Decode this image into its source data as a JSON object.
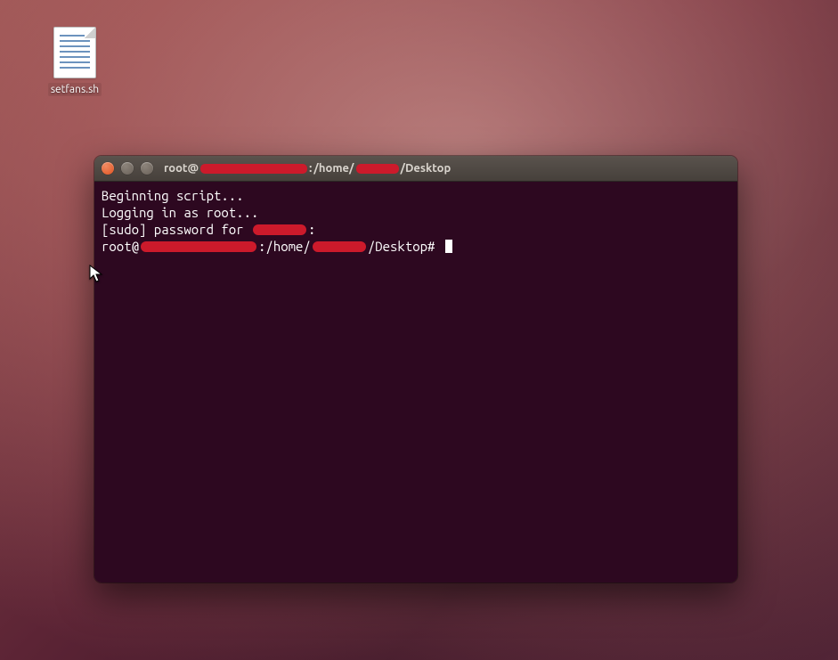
{
  "desktop_icon": {
    "label": "setfans.sh"
  },
  "window": {
    "title_prefix": "root@",
    "title_mid1": ":",
    "title_path1": "/home/",
    "title_path2": "/Desktop"
  },
  "terminal": {
    "line1": "Beginning script...",
    "line2": "Logging in as root...",
    "line3_pre": "[sudo] password for ",
    "line3_post": ":",
    "line4_pre": "root@",
    "line4_mid": ":/home/",
    "line4_post": "/Desktop# "
  }
}
